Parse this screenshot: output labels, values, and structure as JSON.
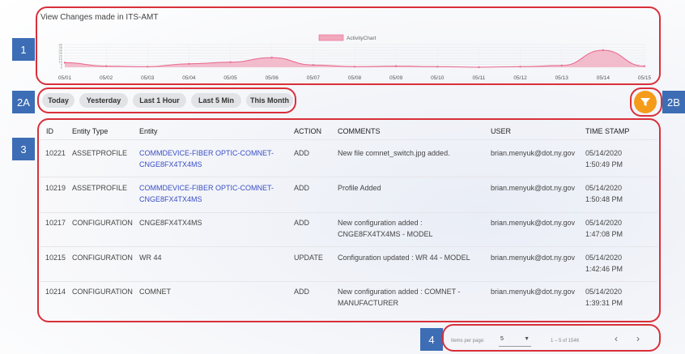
{
  "chart": {
    "title": "View Changes made in ITS-AMT",
    "legend": "ActivityChart",
    "series_color": "#f2a8bd",
    "line_color": "#e8668a"
  },
  "chart_data": {
    "type": "area",
    "title": "View Changes made in ITS-AMT",
    "categories": [
      "05/01",
      "05/02",
      "05/03",
      "05/04",
      "05/05",
      "05/06",
      "05/07",
      "05/08",
      "05/09",
      "05/10",
      "05/11",
      "05/12",
      "05/13",
      "05/14",
      "05/15"
    ],
    "series": [
      {
        "name": "ActivityChart",
        "values": [
          8,
          2,
          1,
          6,
          9,
          17,
          4,
          1,
          2,
          1,
          0,
          1,
          3,
          30,
          2
        ]
      }
    ],
    "ylim": [
      0,
      40
    ],
    "y_ticks": [
      "40",
      "35",
      "30",
      "25",
      "20",
      "15",
      "10",
      "5",
      "0"
    ]
  },
  "tags": {
    "t1": "1",
    "t2a": "2A",
    "t2b": "2B",
    "t3": "3",
    "t4": "4"
  },
  "filters": [
    "Today",
    "Yesterday",
    "Last 1 Hour",
    "Last 5 Min",
    "This Month"
  ],
  "table": {
    "headers": [
      "ID",
      "Entity Type",
      "Entity",
      "ACTION",
      "COMMENTS",
      "USER",
      "TIME STAMP"
    ],
    "rows": [
      {
        "id": "10221",
        "type": "ASSETPROFILE",
        "entity1": "COMMDEVICE-FIBER OPTIC-COMNET-",
        "entity2": "CNGE8FX4TX4MS",
        "link": true,
        "action": "ADD",
        "c1": "New file comnet_switch.jpg added.",
        "c2": "",
        "user": "brian.menyuk@dot.ny.gov",
        "d": "05/14/2020",
        "t": "1:50:49 PM"
      },
      {
        "id": "10219",
        "type": "ASSETPROFILE",
        "entity1": "COMMDEVICE-FIBER OPTIC-COMNET-",
        "entity2": "CNGE8FX4TX4MS",
        "link": true,
        "action": "ADD",
        "c1": "Profile Added",
        "c2": "",
        "user": "brian.menyuk@dot.ny.gov",
        "d": "05/14/2020",
        "t": "1:50:48 PM"
      },
      {
        "id": "10217",
        "type": "CONFIGURATION",
        "entity1": "CNGE8FX4TX4MS",
        "entity2": "",
        "link": false,
        "action": "ADD",
        "c1": "New configuration added :",
        "c2": "CNGE8FX4TX4MS - MODEL",
        "user": "brian.menyuk@dot.ny.gov",
        "d": "05/14/2020",
        "t": "1:47:08 PM"
      },
      {
        "id": "10215",
        "type": "CONFIGURATION",
        "entity1": "WR 44",
        "entity2": "",
        "link": false,
        "action": "UPDATE",
        "c1": "Configuration updated : WR 44 - MODEL",
        "c2": "",
        "user": "brian.menyuk@dot.ny.gov",
        "d": "05/14/2020",
        "t": "1:42:46 PM"
      },
      {
        "id": "10214",
        "type": "CONFIGURATION",
        "entity1": "COMNET",
        "entity2": "",
        "link": false,
        "action": "ADD",
        "c1": "New configuration added : COMNET -",
        "c2": "MANUFACTURER",
        "user": "brian.menyuk@dot.ny.gov",
        "d": "05/14/2020",
        "t": "1:39:31 PM"
      }
    ]
  },
  "pagination": {
    "label": "Items per page:",
    "size": "5",
    "range": "1 – 5 of 1546",
    "prev_icon": "chevron-left-icon",
    "next_icon": "chevron-right-icon"
  }
}
